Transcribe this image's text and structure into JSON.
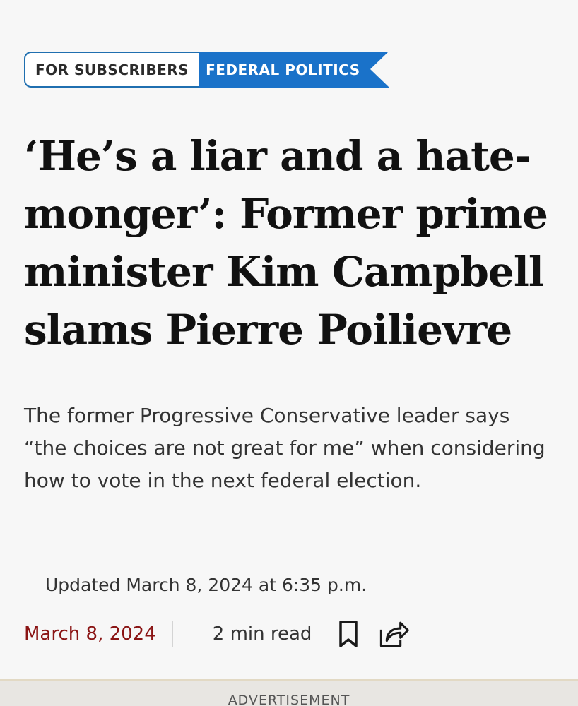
{
  "tags": {
    "subscribers": "FOR SUBSCRIBERS",
    "section": "FEDERAL POLITICS"
  },
  "article": {
    "headline": "‘He’s a liar and a hate-monger’: Former prime minister Kim Campbell slams Pierre Poilievre",
    "subheadline": "The former Progressive Conservative leader says “the choices are not great for me” when considering how to vote in the next federal election.",
    "updated": "Updated March 8, 2024 at 6:35 p.m.",
    "date": "March 8, 2024",
    "read_time": "2 min read"
  },
  "icons": {
    "bookmark": "bookmark-icon",
    "share": "share-icon"
  },
  "ad": {
    "label": "ADVERTISEMENT"
  },
  "colors": {
    "section_tag": "#1a72c9",
    "tag_border": "#1f6fb0",
    "date": "#8a1414",
    "background": "#f7f7f7"
  }
}
